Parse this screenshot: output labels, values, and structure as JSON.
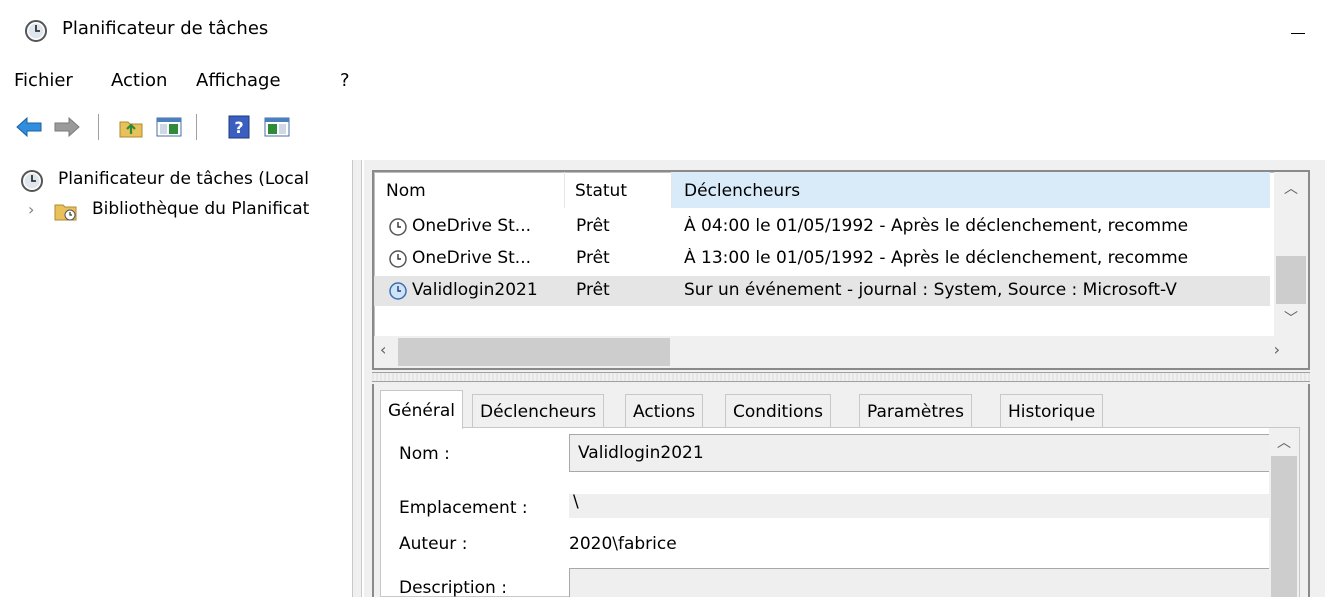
{
  "window": {
    "title": "Planificateur de tâches"
  },
  "menu": [
    "Fichier",
    "Action",
    "Affichage",
    "?"
  ],
  "toolbar": {
    "buttons": [
      "back-icon",
      "forward-icon",
      "up-folder-icon",
      "show-hide-console-tree-icon",
      "help-icon",
      "show-hide-action-pane-icon"
    ]
  },
  "tree": {
    "root_label": "Planificateur de tâches (Local",
    "library_label": "Bibliothèque du Planificat"
  },
  "task_list": {
    "columns": [
      "Nom",
      "Statut",
      "Déclencheurs"
    ],
    "rows": [
      {
        "name": "OneDrive St...",
        "status": "Prêt",
        "trigger": "À 04:00 le 01/05/1992 - Après le déclenchement, recomme"
      },
      {
        "name": "OneDrive St...",
        "status": "Prêt",
        "trigger": "À 13:00 le 01/05/1992 - Après le déclenchement, recomme"
      },
      {
        "name": "Validlogin2021",
        "status": "Prêt",
        "trigger": "Sur un événement - journal : System, Source : Microsoft-V"
      }
    ],
    "selected_index": 2
  },
  "detail": {
    "tabs": [
      "Général",
      "Déclencheurs",
      "Actions",
      "Conditions",
      "Paramètres",
      "Historique"
    ],
    "active_tab": "Général",
    "fields": {
      "name_label": "Nom :",
      "name_value": "Validlogin2021",
      "location_label": "Emplacement :",
      "location_value": "\\",
      "author_label": "Auteur :",
      "author_value": "2020\\fabrice",
      "description_label": "Description :"
    }
  }
}
